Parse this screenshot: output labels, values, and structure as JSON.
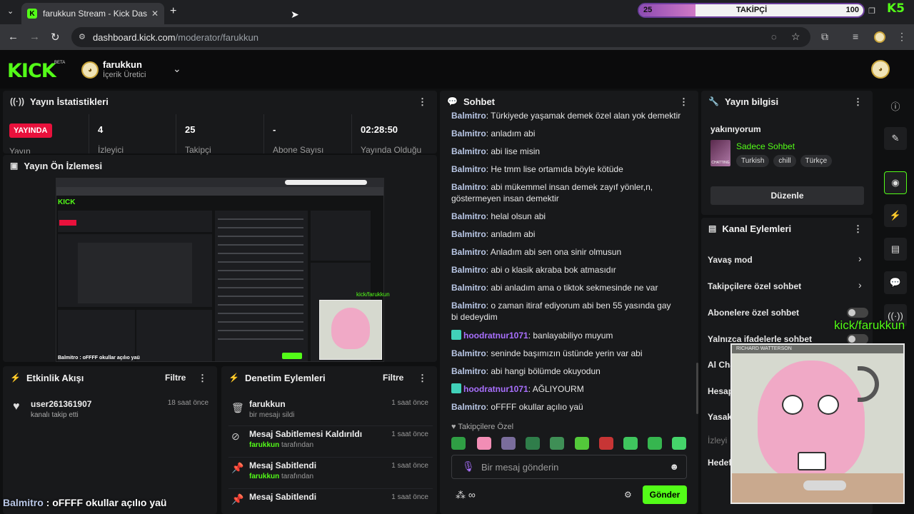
{
  "browser": {
    "tab_title": "farukkun Stream - Kick Dashboard",
    "new_tab": "+",
    "url_host": "dashboard.kick.com",
    "url_path": "/moderator/farukkun"
  },
  "follow_goal": {
    "current": "25",
    "label": "TAKİPÇİ",
    "target": "100",
    "progress": 0.25,
    "brand": "K5"
  },
  "header": {
    "logo": "KICK",
    "logo_tag": "BETA",
    "channel_name": "farukkun",
    "channel_role": "İçerik Üretici"
  },
  "stats": {
    "title": "Yayın İstatistikleri",
    "live_badge": "YAYINDA",
    "partial_label": "Yayın",
    "items": [
      {
        "value": "4",
        "label": "İzleyici"
      },
      {
        "value": "25",
        "label": "Takipçi"
      },
      {
        "value": "-",
        "label": "Abone Sayısı"
      },
      {
        "value": "02:28:50",
        "label": "Yayında Olduğu"
      }
    ]
  },
  "preview": {
    "title": "Yayın Ön İzlemesi",
    "caption": "kick/farukkun"
  },
  "activity": {
    "title": "Etkinlik Akışı",
    "filter": "Filtre",
    "items": [
      {
        "user": "user261361907",
        "desc": "kanalı takip etti",
        "time": "18 saat önce"
      }
    ]
  },
  "mod_actions": {
    "title": "Denetim Eylemleri",
    "filter": "Filtre",
    "items": [
      {
        "title": "farukkun",
        "sub_pre": "",
        "sub_user": "",
        "sub_post": "bir mesajı sildi",
        "time": "1 saat önce"
      },
      {
        "title": "Mesaj Sabitlemesi Kaldırıldı",
        "sub_pre": "",
        "sub_user": "farukkun",
        "sub_post": " tarafından",
        "time": "1 saat önce"
      },
      {
        "title": "Mesaj Sabitlendi",
        "sub_pre": "",
        "sub_user": "farukkun",
        "sub_post": " tarafından",
        "time": "1 saat önce"
      },
      {
        "title": "Mesaj Sabitlendi",
        "sub_pre": "",
        "sub_user": "",
        "sub_post": "",
        "time": "1 saat önce"
      }
    ]
  },
  "chat": {
    "title": "Sohbet",
    "messages": [
      {
        "user": "Balmitro",
        "text": "Türkiyede yaşamak demek özel alan yok demektir",
        "vip": false
      },
      {
        "user": "Balmitro",
        "text": "anladım abi",
        "vip": false
      },
      {
        "user": "Balmitro",
        "text": "abi lise misin",
        "vip": false
      },
      {
        "user": "Balmitro",
        "text": "He tmm lise ortamıda böyle kötüde",
        "vip": false
      },
      {
        "user": "Balmitro",
        "text": "abi mükemmel insan demek zayıf yönler,n, göstermeyen insan demektir",
        "vip": false
      },
      {
        "user": "Balmitro",
        "text": "helal olsun abi",
        "vip": false
      },
      {
        "user": "Balmitro",
        "text": "anladım abi",
        "vip": false
      },
      {
        "user": "Balmitro",
        "text": "Anladım abi sen ona sinir olmusun",
        "vip": false
      },
      {
        "user": "Balmitro",
        "text": "abi o klasik akraba bok atmasıdır",
        "vip": false
      },
      {
        "user": "Balmitro",
        "text": "abi anladım ama o tiktok sekmesinde ne var",
        "vip": false
      },
      {
        "user": "Balmitro",
        "text": "o zaman itiraf ediyorum abi ben 55 yasında gay bi dedeydim",
        "vip": false
      },
      {
        "user": "hoodratnur1071",
        "text": "banlayabiliyo muyum",
        "vip": true
      },
      {
        "user": "Balmitro",
        "text": "seninde başımızın üstünde yerin var abi",
        "vip": false
      },
      {
        "user": "Balmitro",
        "text": "abi hangi bölümde okuyodun",
        "vip": false
      },
      {
        "user": "hoodratnur1071",
        "text": "AĞLIYOURM",
        "vip": true
      },
      {
        "user": "Balmitro",
        "text": "oFFFF okullar açılıo yaü",
        "vip": false
      }
    ],
    "emote_section": "Takipçilere Özel",
    "input_placeholder": "Bir mesaj gönderin",
    "send_label": "Gönder"
  },
  "stream_info": {
    "title": "Yayın bilgisi",
    "stream_title": "yakınıyorum",
    "category": "Sadece Sohbet",
    "category_thumb": "CHATTING",
    "tags": [
      "Turkish",
      "chill",
      "Türkçe"
    ],
    "edit_label": "Düzenle"
  },
  "channel_actions": {
    "title": "Kanal Eylemleri",
    "items": [
      {
        "label": "Yavaş mod",
        "kind": "arrow"
      },
      {
        "label": "Takipçilere özel sohbet",
        "kind": "arrow"
      },
      {
        "label": "Abonelere özel sohbet",
        "kind": "toggle"
      },
      {
        "label": "Yalnızca ifadelerle sohbet",
        "kind": "toggle"
      },
      {
        "label": "Al Cha",
        "kind": "none"
      },
      {
        "label": "Hesap",
        "kind": "none"
      },
      {
        "label": "Yasak",
        "kind": "none"
      },
      {
        "label": "İzleyi",
        "kind": "none"
      },
      {
        "label": "Hedefleri b",
        "kind": "none"
      }
    ]
  },
  "overlay": {
    "cam_label": "kick/farukkun",
    "cam_title": "RICHARD WATTERSON",
    "caption_user": "Balmitro",
    "caption_text": " : oFFFF okullar açılıo yaü"
  },
  "colors": {
    "brand": "#53fc18",
    "live": "#e9113c",
    "panel": "#18191b"
  }
}
